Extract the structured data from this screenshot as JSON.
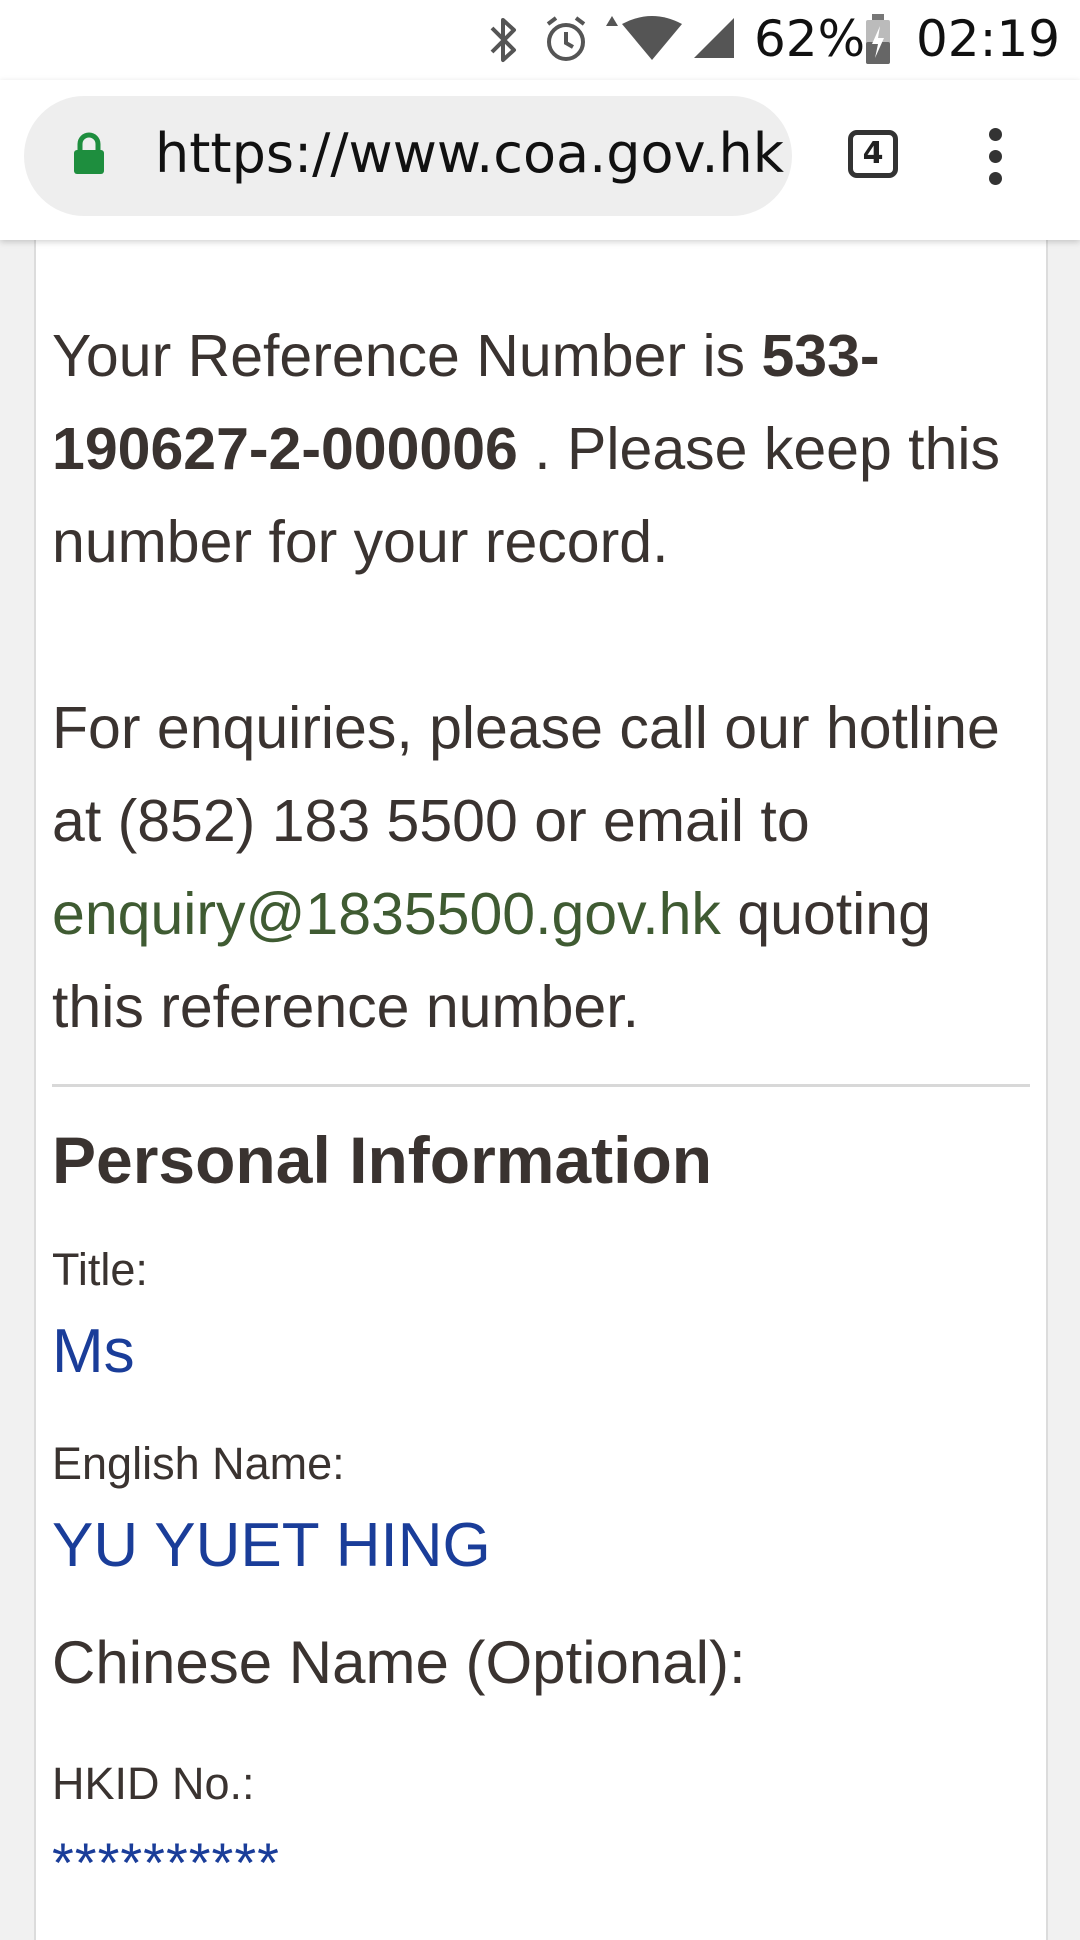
{
  "status_bar": {
    "icons": [
      "bluetooth-icon",
      "alarm-icon",
      "wifi-icon",
      "cell-signal-icon",
      "battery-charging-icon"
    ],
    "battery_percent": "62%",
    "time": "02:19"
  },
  "browser": {
    "url": "https://www.coa.gov.hk",
    "tab_count": "4",
    "accent_secure": "#1e8e3e"
  },
  "content": {
    "reference": {
      "prefix": "Your Reference Number is ",
      "number": "533-190627-2-000006",
      "suffix": " . Please keep this number for your record."
    },
    "enquiry": {
      "prefix": "For enquiries, please call our hotline at (852) 183 5500 or email to ",
      "email": "enquiry@1835500.gov.hk",
      "suffix": " quoting this reference number."
    },
    "section_title": "Personal Information",
    "fields": {
      "title_label": "Title:",
      "title_value": "Ms",
      "english_name_label": "English Name:",
      "english_name_value": "YU YUET HING",
      "chinese_name_label": "Chinese Name (Optional):",
      "hkid_label": "HKID No.:",
      "hkid_value": "**********"
    },
    "colors": {
      "text": "#3a3330",
      "value": "#1a3d99",
      "link": "#3f5b32"
    }
  }
}
